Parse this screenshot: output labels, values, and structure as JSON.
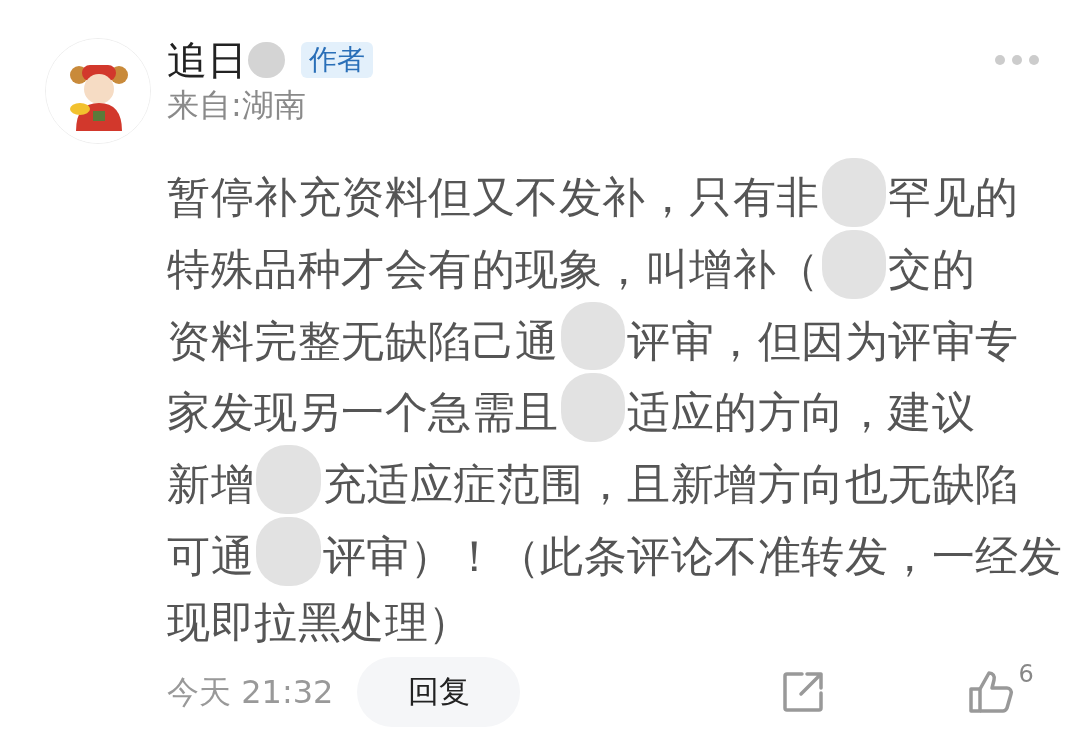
{
  "comment": {
    "author": {
      "name": "追日",
      "name_redacted": true,
      "badge": "作者",
      "location": "来自:湖南"
    },
    "body_lines": [
      {
        "segments": [
          "暂停补充资料但又不发补，只有非",
          "罕见的"
        ]
      },
      {
        "segments": [
          "特殊品种才会有的现象，叫增补（",
          "交的"
        ]
      },
      {
        "segments": [
          "资料完整无缺陷己通",
          "评审，但因为评审专"
        ]
      },
      {
        "segments": [
          "家发现另一个急需且",
          "适应的方向，建议"
        ]
      },
      {
        "segments": [
          "新增",
          "充适应症范围，且新增方向也无缺陷"
        ]
      },
      {
        "segments": [
          "可通",
          "评审）！（此条评论不准转发，一经发"
        ]
      },
      {
        "segments": [
          "现即拉黑处理）"
        ]
      }
    ],
    "time": "今天 21:32",
    "reply_button": "回复",
    "like_count": "6"
  }
}
